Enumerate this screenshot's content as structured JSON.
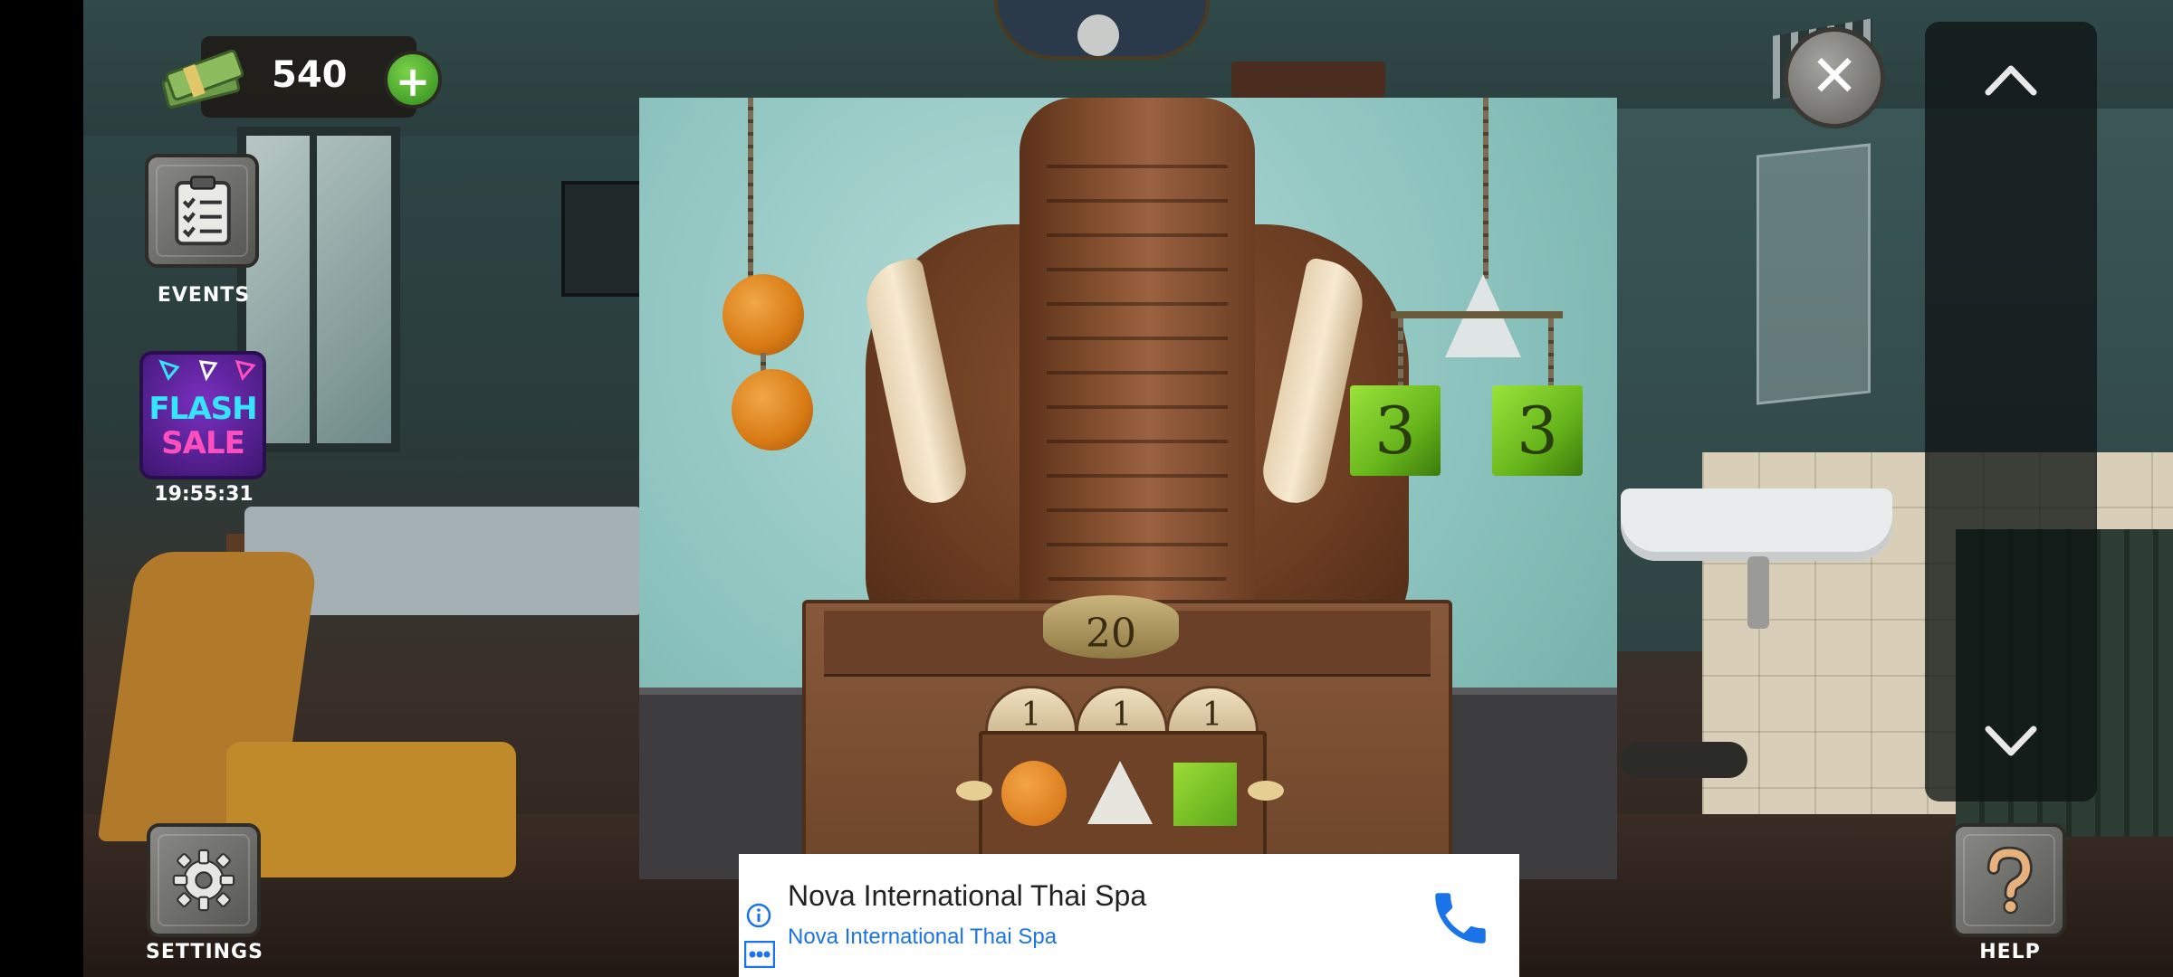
{
  "hud": {
    "money": "540",
    "plus_symbol": "+",
    "events_label": "EVENTS",
    "flash_sale_line1": "FLASH",
    "flash_sale_line2": "SALE",
    "flash_sale_timer": "19:55:31",
    "settings_label": "SETTINGS",
    "help_label": "HELP",
    "close_symbol": "✕"
  },
  "puzzle": {
    "elephant_ring_number": "20",
    "slot_numbers": [
      "1",
      "1",
      "1"
    ],
    "cube_numbers": [
      "3",
      "3"
    ],
    "symbols": [
      "circle",
      "triangle",
      "square"
    ]
  },
  "ad": {
    "title": "Nova International Thai Spa",
    "subtitle": "Nova International Thai Spa"
  },
  "icons": {
    "money": "money-stack-icon",
    "events": "clipboard-checklist-icon",
    "settings": "gear-icon",
    "help": "question-mark-icon",
    "close": "close-icon",
    "scroll_up": "chevron-up-icon",
    "scroll_down": "chevron-down-icon",
    "ad_info": "info-icon",
    "ad_phone": "phone-icon"
  },
  "colors": {
    "ad_link": "#1a73e8",
    "plus_button": "#3fa827",
    "flash_cyan": "#35e4ff",
    "flash_pink": "#ff4fbf"
  }
}
